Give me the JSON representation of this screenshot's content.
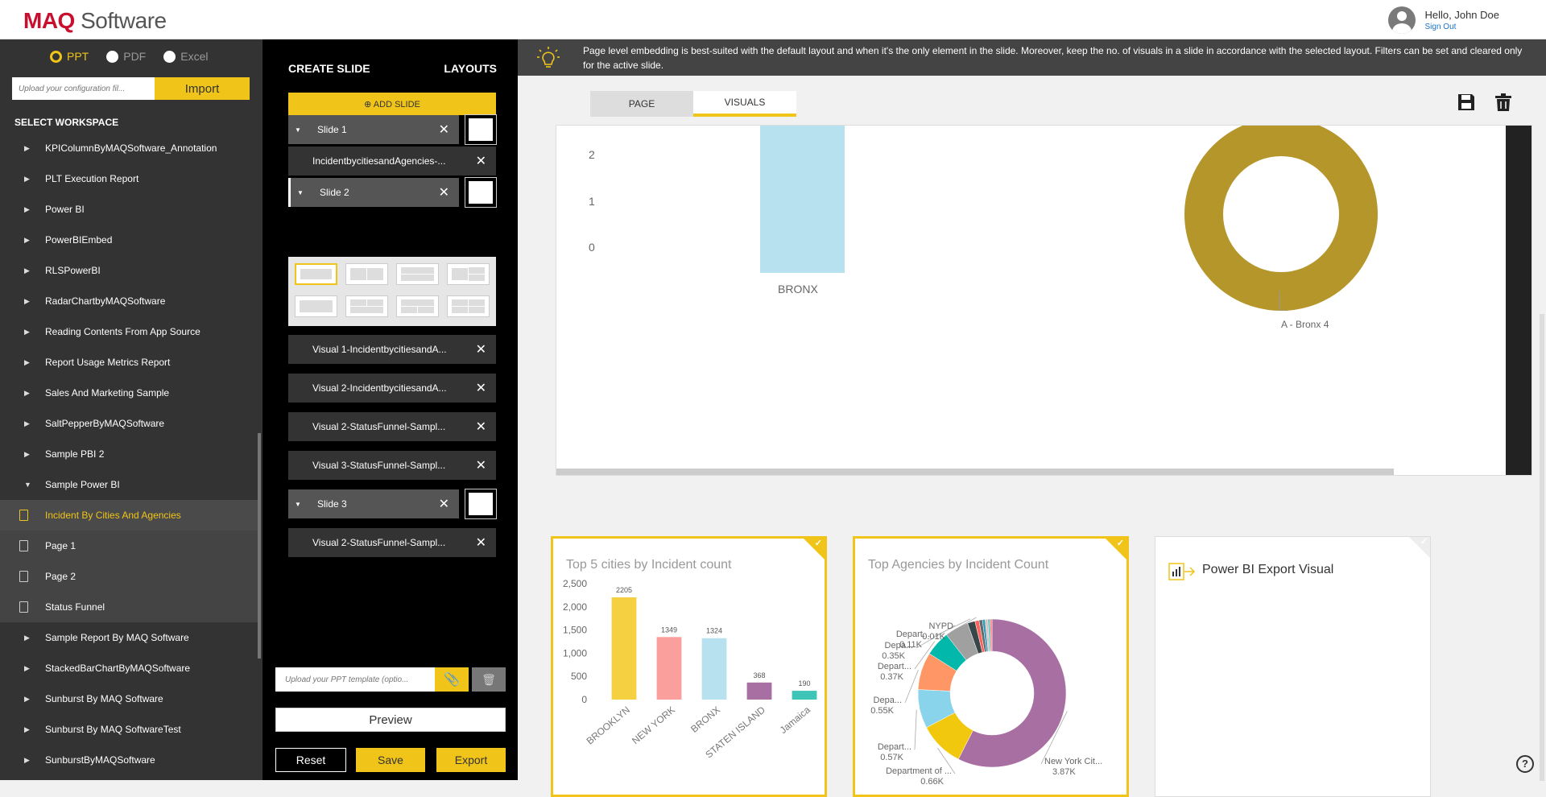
{
  "header": {
    "logo_brand": "MAQ",
    "logo_suffix": "Software",
    "greeting": "Hello, John Doe",
    "signout": "Sign Out"
  },
  "sidebar": {
    "formats": [
      "PPT",
      "PDF",
      "Excel"
    ],
    "selected_format": "PPT",
    "config_placeholder": "Upload your configuration fil...",
    "import_label": "Import",
    "workspace_title": "SELECT WORKSPACE",
    "workspaces": [
      {
        "label": "KPIColumnByMAQSoftware_Annotation",
        "type": "collapsed"
      },
      {
        "label": "PLT Execution Report",
        "type": "collapsed"
      },
      {
        "label": "Power BI",
        "type": "collapsed"
      },
      {
        "label": "PowerBIEmbed",
        "type": "collapsed"
      },
      {
        "label": "RLSPowerBI",
        "type": "collapsed"
      },
      {
        "label": "RadarChartbyMAQSoftware",
        "type": "collapsed"
      },
      {
        "label": "Reading Contents From App Source",
        "type": "collapsed"
      },
      {
        "label": "Report Usage Metrics Report",
        "type": "collapsed"
      },
      {
        "label": "Sales And Marketing Sample",
        "type": "collapsed"
      },
      {
        "label": "SaltPepperByMAQSoftware",
        "type": "collapsed"
      },
      {
        "label": "Sample PBI 2",
        "type": "collapsed"
      },
      {
        "label": "Sample Power BI",
        "type": "expanded"
      },
      {
        "label": "Incident By Cities And Agencies",
        "type": "page",
        "active": true
      },
      {
        "label": "Page 1",
        "type": "page"
      },
      {
        "label": "Page 2",
        "type": "page"
      },
      {
        "label": "Status Funnel",
        "type": "page"
      },
      {
        "label": "Sample Report By MAQ Software",
        "type": "collapsed"
      },
      {
        "label": "StackedBarChartByMAQSoftware",
        "type": "collapsed"
      },
      {
        "label": "Sunburst By MAQ Software",
        "type": "collapsed"
      },
      {
        "label": "Sunburst By MAQ SoftwareTest",
        "type": "collapsed"
      },
      {
        "label": "SunburstByMAQSoftware",
        "type": "collapsed"
      }
    ]
  },
  "slides_panel": {
    "create_title": "CREATE SLIDE",
    "layouts_title": "LAYOUTS",
    "add_slide": "ADD SLIDE",
    "slide1": "Slide 1",
    "slide1_visual": "IncidentbycitiesandAgencies-...",
    "slide2": "Slide 2",
    "slide2_visuals": [
      "Visual 1-IncidentbycitiesandA...",
      "Visual 2-IncidentbycitiesandA...",
      "Visual 2-StatusFunnel-Sampl...",
      "Visual 3-StatusFunnel-Sampl..."
    ],
    "slide3": "Slide 3",
    "slide3_visual": "Visual 2-StatusFunnel-Sampl...",
    "ppt_placeholder": "Upload your PPT template (optio...",
    "preview": "Preview",
    "reset": "Reset",
    "save": "Save",
    "export": "Export"
  },
  "main": {
    "banner": "Page level embedding is best-suited with the default layout and when it's the only element in the slide. Moreover, keep the no. of visuals in a slide in accordance with the selected layout. Filters can be set and cleared only for the active slide.",
    "tabs": [
      "PAGE",
      "VISUALS"
    ],
    "active_tab": "VISUALS",
    "preview_yticks": [
      "2",
      "1",
      "0"
    ],
    "preview_bar_label": "BRONX",
    "preview_donut_label": "A - Bronx 4",
    "card1_title": "Top 5 cities by Incident count",
    "card2_title": "Top Agencies by Incident Count",
    "card3_title": "Power BI Export Visual"
  },
  "colors": {
    "accent": "#f0c419",
    "brand_red": "#c8102e",
    "sidebar_bg": "#333333",
    "donut_gold": "#b5962b"
  },
  "chart_data": [
    {
      "type": "bar",
      "title": "Top 5 cities by Incident count",
      "categories": [
        "BROOKLYN",
        "NEW YORK",
        "BRONX",
        "STATEN ISLAND",
        "Jamaica"
      ],
      "values": [
        2205,
        1349,
        1324,
        368,
        190
      ],
      "ylim": [
        0,
        2500
      ],
      "yticks": [
        "2,500",
        "2,000",
        "1,500",
        "1,000",
        "500",
        "0"
      ],
      "colors": [
        "#f5d142",
        "#fb9f9c",
        "#b8e1f0",
        "#a86fa3",
        "#3fc4b8"
      ]
    },
    {
      "type": "pie",
      "title": "Top Agencies by Incident Count",
      "slices": [
        {
          "label": "New York Cit...",
          "value_label": "3.87K",
          "value": 3870,
          "color": "#a86fa3"
        },
        {
          "label": "Department of ...",
          "value_label": "0.66K",
          "value": 660,
          "color": "#f2c80f"
        },
        {
          "label": "Depart...",
          "value_label": "0.57K",
          "value": 570,
          "color": "#8ad4eb"
        },
        {
          "label": "Depa...",
          "value_label": "0.55K",
          "value": 550,
          "color": "#fe9666"
        },
        {
          "label": "Depart...",
          "value_label": "0.37K",
          "value": 370,
          "color": "#01b8aa"
        },
        {
          "label": "Depa...",
          "value_label": "0.35K",
          "value": 350,
          "color": "#a0a0a0"
        },
        {
          "label": "Depart...",
          "value_label": "0.11K",
          "value": 110,
          "color": "#374649"
        },
        {
          "label": "NYPD",
          "value_label": "0.01K",
          "value": 60,
          "color": "#fd625e"
        },
        {
          "label": "",
          "value_label": "",
          "value": 50,
          "color": "#5f6b6d"
        },
        {
          "label": "",
          "value_label": "",
          "value": 40,
          "color": "#3599b8"
        },
        {
          "label": "",
          "value_label": "",
          "value": 40,
          "color": "#dfbfbf"
        },
        {
          "label": "",
          "value_label": "",
          "value": 30,
          "color": "#4ac5bb"
        },
        {
          "label": "",
          "value_label": "",
          "value": 30,
          "color": "#fb8281"
        }
      ]
    }
  ]
}
